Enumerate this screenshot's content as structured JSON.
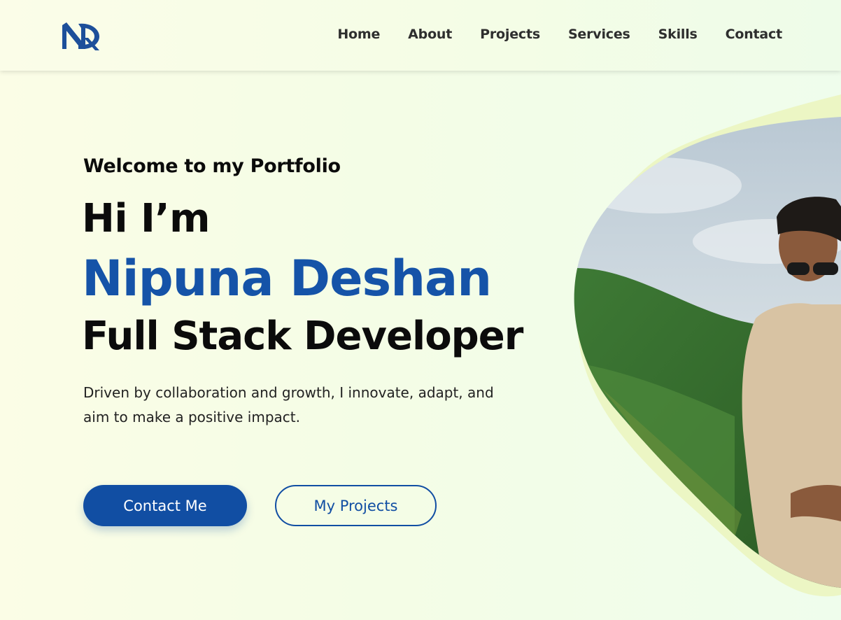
{
  "nav": {
    "logo_label": "ND",
    "items": [
      {
        "label": "Home"
      },
      {
        "label": "About"
      },
      {
        "label": "Projects"
      },
      {
        "label": "Services"
      },
      {
        "label": "Skills"
      },
      {
        "label": "Contact"
      }
    ]
  },
  "hero": {
    "welcome": "Welcome to my Portfolio",
    "greeting": "Hi I’m",
    "name": "Nipuna Deshan",
    "role": "Full Stack Developer",
    "description": "Driven by collaboration and growth, I innovate, adapt, and aim to make a positive impact.",
    "primary_button": "Contact Me",
    "secondary_button": "My Projects",
    "photo": "profile-photo"
  },
  "colors": {
    "accent": "#114ea3",
    "name_blue": "#1553a8",
    "blob_lime": "#ecf6c4"
  }
}
